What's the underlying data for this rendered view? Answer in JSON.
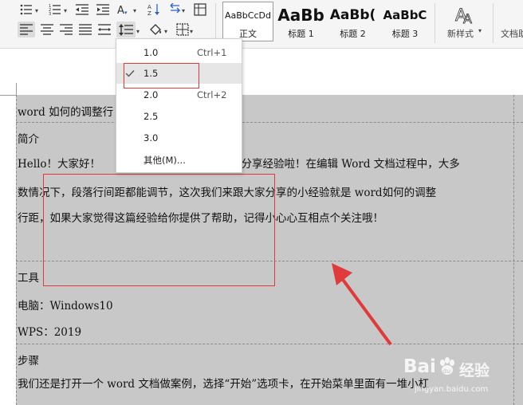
{
  "ribbon": {
    "styles": [
      {
        "sample": "AaBbCcDd",
        "label": "正文",
        "active": true
      },
      {
        "sample": "AaBb",
        "label": "标题 1"
      },
      {
        "sample": "AaBb(",
        "label": "标题 2"
      },
      {
        "sample": "AaBbC",
        "label": "标题 3"
      }
    ],
    "new_style_label": "新样式",
    "new_style_dropdown": "▾",
    "doc_assistant_label": "文档助"
  },
  "line_spacing_menu": {
    "items": [
      {
        "label": "1.0",
        "shortcut": "Ctrl+1"
      },
      {
        "label": "1.5",
        "shortcut": "",
        "checked": true,
        "highlighted": true
      },
      {
        "label": "2.0",
        "shortcut": "Ctrl+2"
      },
      {
        "label": "2.5",
        "shortcut": ""
      },
      {
        "label": "3.0",
        "shortcut": ""
      },
      {
        "label": "其他(M)...",
        "shortcut": ""
      }
    ]
  },
  "document": {
    "title_line": "word 如何的调整行",
    "intro_heading": "简介",
    "intro_para": [
      {
        "left": "Hello！大家好！",
        "right": "家分享经验啦！在编辑 Word 文档过程中，大多"
      },
      "数情况下，段落行间距都能调节，这次我们来跟大家分享的小经验就是 word如何的调整",
      "行距，如果大家觉得这篇经验给你提供了帮助，记得小心心互相点个关注哦！"
    ],
    "tools_heading": "工具",
    "tools_items": [
      "电脑：Windows10",
      "WPS：2019"
    ],
    "steps_heading": "步骤",
    "steps_para": "我们还是打开一个 word 文档做案例，选择“开始”选项卡，在开始菜单里面有一堆小杠"
  },
  "watermark": {
    "brand": "Bai",
    "paw": "du",
    "suffix": "经验",
    "url": "jingyan.baidu.com"
  },
  "colors": {
    "annotation_red": "#e03a3a",
    "selection_gray": "#c8c8c8"
  }
}
